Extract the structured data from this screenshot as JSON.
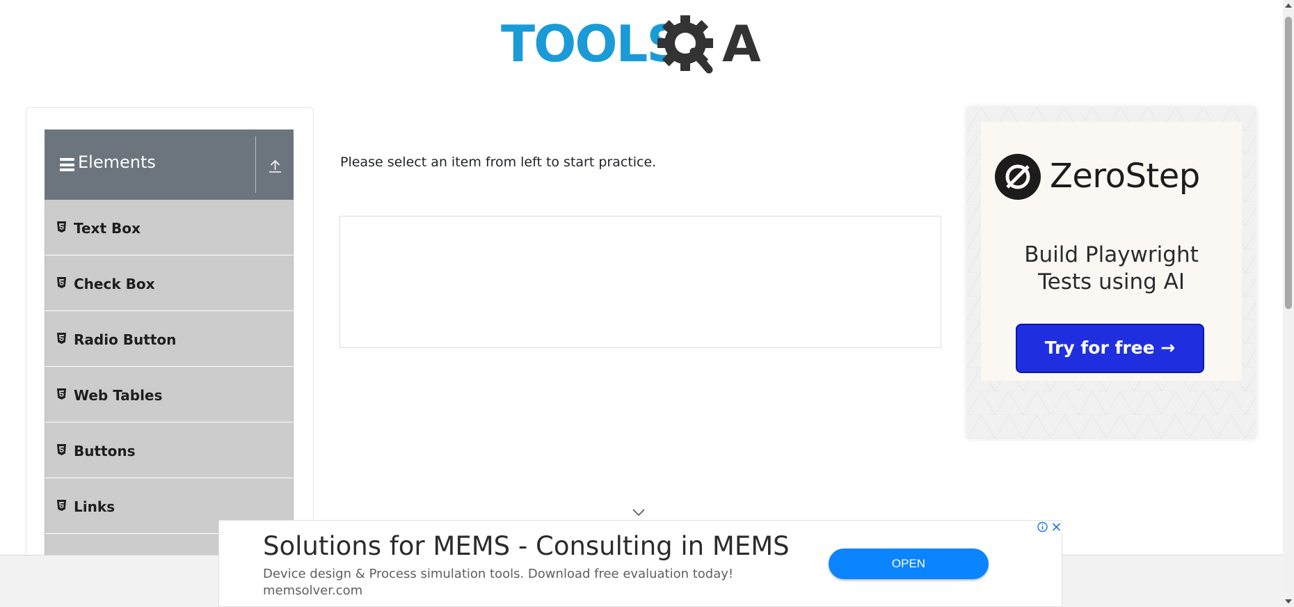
{
  "header": {
    "logo_text_blue": "TOOLS",
    "logo_text_dark": "QA",
    "logo_colors": {
      "blue": "#1a9bd7",
      "dark": "#333333"
    }
  },
  "sidebar": {
    "group_title": "Elements",
    "header_color": "#6c757d",
    "items": [
      {
        "label": "Text Box",
        "icon": "html5-icon"
      },
      {
        "label": "Check Box",
        "icon": "html5-icon"
      },
      {
        "label": "Radio Button",
        "icon": "html5-icon"
      },
      {
        "label": "Web Tables",
        "icon": "html5-icon"
      },
      {
        "label": "Buttons",
        "icon": "html5-icon"
      },
      {
        "label": "Links",
        "icon": "html5-icon"
      }
    ]
  },
  "main": {
    "intro_text": "Please select an item from left to start practice."
  },
  "ad_right": {
    "brand": "ZeroStep",
    "headline_line1": "Build Playwright",
    "headline_line2": "Tests using AI",
    "cta": "Try for free →",
    "cta_color": "#1f2fe0"
  },
  "ad_bottom": {
    "title": "Solutions for MEMS - Consulting in MEMS",
    "description": "Device design & Process simulation tools. Download free evaluation today!",
    "url": "memsolver.com",
    "button": "OPEN",
    "button_color": "#0a84ff"
  }
}
